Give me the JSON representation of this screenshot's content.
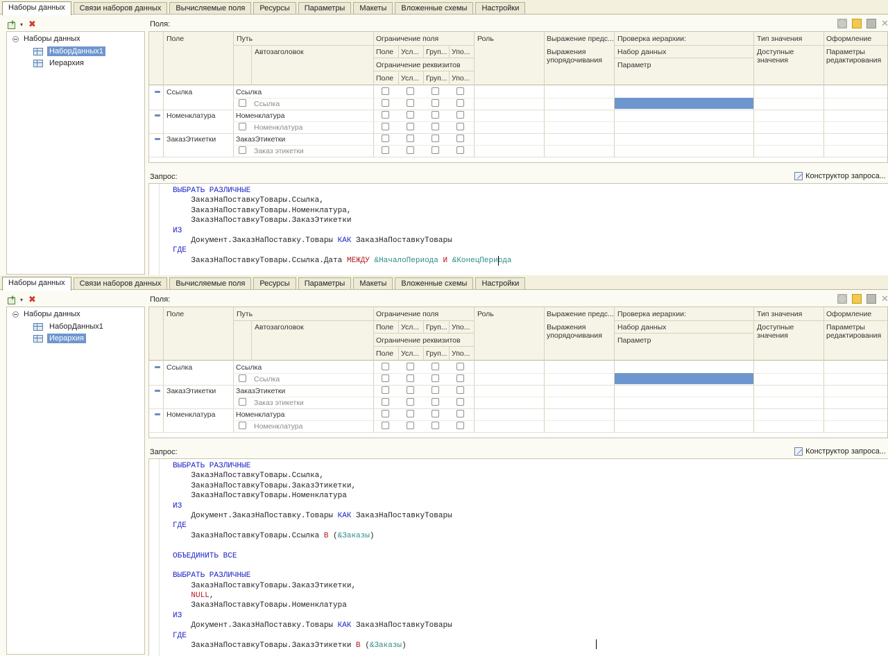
{
  "tabs": [
    "Наборы данных",
    "Связи наборов данных",
    "Вычисляемые поля",
    "Ресурсы",
    "Параметры",
    "Макеты",
    "Вложенные схемы",
    "Настройки"
  ],
  "tree": {
    "root": "Наборы данных",
    "items": [
      "НаборДанных1",
      "Иерархия"
    ]
  },
  "fields_label": "Поля:",
  "query_label": "Запрос:",
  "constructor_label": "Конструктор запроса...",
  "headers": {
    "pole": "Поле",
    "put": "Путь",
    "autoheader": "Автозаголовок",
    "field_restriction": "Ограничение поля",
    "sub_pole": "Поле",
    "sub_usl": "Усл...",
    "sub_grup": "Груп...",
    "sub_upo": "Упо...",
    "attr_restriction": "Ограничение реквизитов",
    "role": "Роль",
    "expr": "Выражение предс...",
    "expr_sub": "Выражения упорядочивания",
    "hier": "Проверка иерархии:",
    "hier_set": "Набор данных",
    "hier_param": "Параметр",
    "type": "Тип значения",
    "type_sub": "Доступные значения",
    "format": "Оформление",
    "format_sub": "Параметры редактирования"
  },
  "panel1": {
    "active_tree_item": "НаборДанных1",
    "rows": [
      {
        "field": "Ссылка",
        "path": "Ссылка",
        "title": "Ссылка"
      },
      {
        "field": "Номенклатура",
        "path": "Номенклатура",
        "title": "Номенклатура"
      },
      {
        "field": "ЗаказЭтикетки",
        "path": "ЗаказЭтикетки",
        "title": "Заказ этикетки"
      }
    ]
  },
  "panel2": {
    "active_tree_item": "Иерархия",
    "rows": [
      {
        "field": "Ссылка",
        "path": "Ссылка",
        "title": "Ссылка"
      },
      {
        "field": "ЗаказЭтикетки",
        "path": "ЗаказЭтикетки",
        "title": "Заказ этикетки"
      },
      {
        "field": "Номенклатура",
        "path": "Номенклатура",
        "title": "Номенклатура"
      }
    ]
  },
  "query1": [
    [
      [
        "kw",
        "ВЫБРАТЬ РАЗЛИЧНЫЕ"
      ]
    ],
    [
      [
        "t",
        "    ЗаказНаПоставкуТовары.Ссылка,"
      ]
    ],
    [
      [
        "t",
        "    ЗаказНаПоставкуТовары.Номенклатура,"
      ]
    ],
    [
      [
        "t",
        "    ЗаказНаПоставкуТовары.ЗаказЭтикетки"
      ]
    ],
    [
      [
        "kw",
        "ИЗ"
      ]
    ],
    [
      [
        "t",
        "    Документ.ЗаказНаПоставку.Товары "
      ],
      [
        "kw",
        "КАК"
      ],
      [
        "t",
        " ЗаказНаПоставкуТовары"
      ]
    ],
    [
      [
        "kw",
        "ГДЕ"
      ]
    ],
    [
      [
        "t",
        "    ЗаказНаПоставкуТовары.Ссылка.Дата "
      ],
      [
        "rd",
        "МЕЖДУ"
      ],
      [
        "t",
        " "
      ],
      [
        "pr",
        "&НачалоПериода"
      ],
      [
        "t",
        " "
      ],
      [
        "rd",
        "И"
      ],
      [
        "t",
        " "
      ],
      [
        "pr",
        "&КонецПериода"
      ]
    ]
  ],
  "query2": [
    [
      [
        "kw",
        "ВЫБРАТЬ РАЗЛИЧНЫЕ"
      ]
    ],
    [
      [
        "t",
        "    ЗаказНаПоставкуТовары.Ссылка,"
      ]
    ],
    [
      [
        "t",
        "    ЗаказНаПоставкуТовары.ЗаказЭтикетки,"
      ]
    ],
    [
      [
        "t",
        "    ЗаказНаПоставкуТовары.Номенклатура"
      ]
    ],
    [
      [
        "kw",
        "ИЗ"
      ]
    ],
    [
      [
        "t",
        "    Документ.ЗаказНаПоставку.Товары "
      ],
      [
        "kw",
        "КАК"
      ],
      [
        "t",
        " ЗаказНаПоставкуТовары"
      ]
    ],
    [
      [
        "kw",
        "ГДЕ"
      ]
    ],
    [
      [
        "t",
        "    ЗаказНаПоставкуТовары.Ссылка "
      ],
      [
        "rd",
        "В"
      ],
      [
        "t",
        " ("
      ],
      [
        "pr",
        "&Заказы"
      ],
      [
        "t",
        ")"
      ]
    ],
    [
      [
        "t",
        ""
      ]
    ],
    [
      [
        "kw",
        "ОБЪЕДИНИТЬ ВСЕ"
      ]
    ],
    [
      [
        "t",
        ""
      ]
    ],
    [
      [
        "kw",
        "ВЫБРАТЬ РАЗЛИЧНЫЕ"
      ]
    ],
    [
      [
        "t",
        "    ЗаказНаПоставкуТовары.ЗаказЭтикетки,"
      ]
    ],
    [
      [
        "t",
        "    "
      ],
      [
        "rd",
        "NULL"
      ],
      [
        "t",
        ","
      ]
    ],
    [
      [
        "t",
        "    ЗаказНаПоставкуТовары.Номенклатура"
      ]
    ],
    [
      [
        "kw",
        "ИЗ"
      ]
    ],
    [
      [
        "t",
        "    Документ.ЗаказНаПоставку.Товары "
      ],
      [
        "kw",
        "КАК"
      ],
      [
        "t",
        " ЗаказНаПоставкуТовары"
      ]
    ],
    [
      [
        "kw",
        "ГДЕ"
      ]
    ],
    [
      [
        "t",
        "    ЗаказНаПоставкуТовары.ЗаказЭтикетки "
      ],
      [
        "rd",
        "В"
      ],
      [
        "t",
        " ("
      ],
      [
        "pr",
        "&Заказы"
      ],
      [
        "t",
        ")"
      ]
    ]
  ],
  "colors": {
    "selection": "#6e96ce",
    "keyword": "#1a22c4",
    "operator": "#b3171f",
    "parameter": "#2e8c8c"
  }
}
